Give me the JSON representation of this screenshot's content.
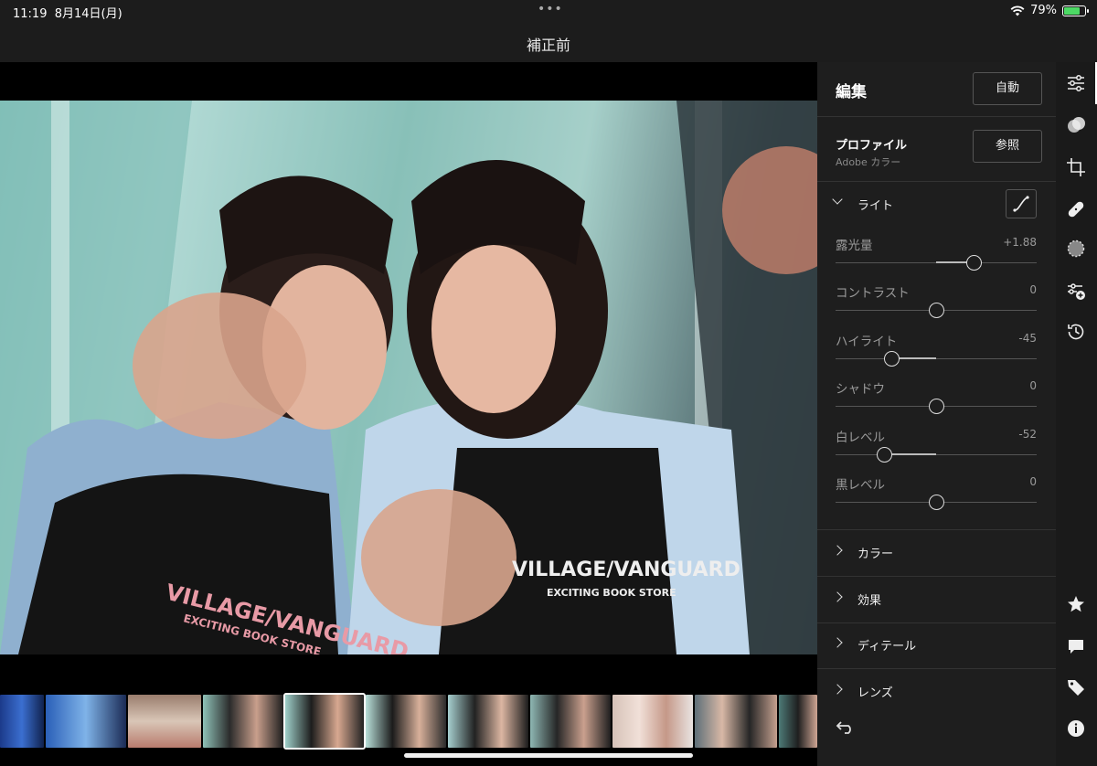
{
  "status": {
    "time": "11:19",
    "date": "8月14日(月)",
    "dots": "•••",
    "battery": "79%",
    "battery_level": 0.79
  },
  "title": "補正前",
  "panel": {
    "title": "編集",
    "auto_label": "自動",
    "profile_label": "プロファイル",
    "profile_value": "Adobe カラー",
    "browse_label": "参照",
    "light": {
      "label": "ライト",
      "sliders": [
        {
          "label": "露光量",
          "value": "+1.88",
          "level": 0.376
        },
        {
          "label": "コントラスト",
          "value": "0",
          "level": 0
        },
        {
          "label": "ハイライト",
          "value": "-45",
          "level": -0.45
        },
        {
          "label": "シャドウ",
          "value": "0",
          "level": 0
        },
        {
          "label": "白レベル",
          "value": "-52",
          "level": -0.52
        },
        {
          "label": "黒レベル",
          "value": "0",
          "level": 0
        }
      ]
    },
    "sections": [
      {
        "label": "カラー"
      },
      {
        "label": "効果"
      },
      {
        "label": "ディテール"
      },
      {
        "label": "レンズ"
      }
    ]
  },
  "colors": {
    "panel": "#1e1e1e",
    "slider_thumb": "#dddddd",
    "accent_battery": "#4cd964"
  },
  "rail_icons": [
    "edit-sliders-icon",
    "masking-icon",
    "crop-icon",
    "healing-icon",
    "selective-icon",
    "presets-icon",
    "history-icon",
    "star-icon",
    "comment-icon",
    "tag-icon",
    "info-icon"
  ],
  "photo_text": {
    "apron_left_brand": "VILLAGE/VANGUARD",
    "apron_left_sub": "EXCITING BOOK STORE",
    "apron_right_brand": "VILLAGE/VANGUARD",
    "apron_right_sub": "EXCITING BOOK STORE"
  }
}
